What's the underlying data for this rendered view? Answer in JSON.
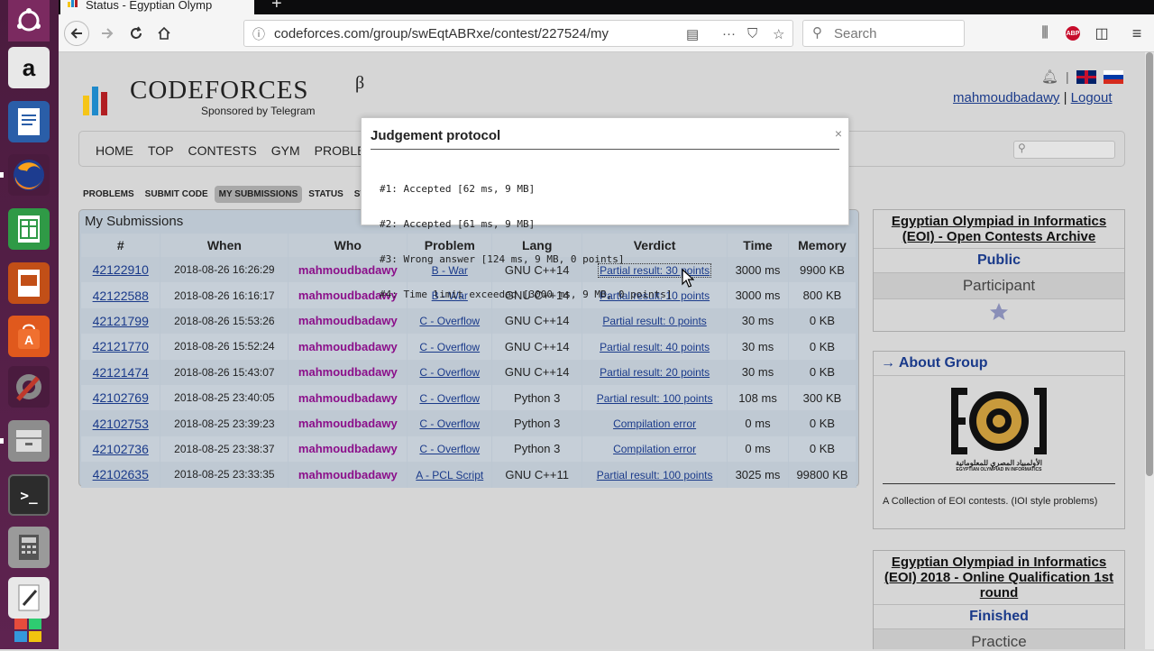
{
  "browser": {
    "tab_title": "Status - Egyptian Olymp",
    "url": "codeforces.com/group/swEqtABRxe/contest/227524/my",
    "search_placeholder": "Search"
  },
  "header": {
    "logo_text": "CODEFORCES",
    "logo_beta": "β",
    "sponsor": "Sponsored by Telegram",
    "username": "mahmoudbadawy",
    "separator": "|",
    "logout": "Logout"
  },
  "menu": [
    "HOME",
    "TOP",
    "CONTESTS",
    "GYM",
    "PROBLEMSET"
  ],
  "subnav": [
    "PROBLEMS",
    "SUBMIT CODE",
    "MY SUBMISSIONS",
    "STATUS",
    "STANDIN"
  ],
  "submissions": {
    "title": "My Submissions",
    "columns": [
      "#",
      "When",
      "Who",
      "Problem",
      "Lang",
      "Verdict",
      "Time",
      "Memory"
    ],
    "rows": [
      {
        "id": "42122910",
        "when": "2018-08-26 16:26:29",
        "who": "mahmoudbadawy",
        "problem": "B - War",
        "lang": "GNU C++14",
        "verdict": "Partial result: 30 points",
        "time": "3000 ms",
        "memory": "9900 KB"
      },
      {
        "id": "42122588",
        "when": "2018-08-26 16:16:17",
        "who": "mahmoudbadawy",
        "problem": "B - War",
        "lang": "GNU C++14",
        "verdict": "Partial result: 10 points",
        "time": "3000 ms",
        "memory": "800 KB"
      },
      {
        "id": "42121799",
        "when": "2018-08-26 15:53:26",
        "who": "mahmoudbadawy",
        "problem": "C - Overflow",
        "lang": "GNU C++14",
        "verdict": "Partial result: 0 points",
        "time": "30 ms",
        "memory": "0 KB"
      },
      {
        "id": "42121770",
        "when": "2018-08-26 15:52:24",
        "who": "mahmoudbadawy",
        "problem": "C - Overflow",
        "lang": "GNU C++14",
        "verdict": "Partial result: 40 points",
        "time": "30 ms",
        "memory": "0 KB"
      },
      {
        "id": "42121474",
        "when": "2018-08-26 15:43:07",
        "who": "mahmoudbadawy",
        "problem": "C - Overflow",
        "lang": "GNU C++14",
        "verdict": "Partial result: 20 points",
        "time": "30 ms",
        "memory": "0 KB"
      },
      {
        "id": "42102769",
        "when": "2018-08-25 23:40:05",
        "who": "mahmoudbadawy",
        "problem": "C - Overflow",
        "lang": "Python 3",
        "verdict": "Partial result: 100 points",
        "time": "108 ms",
        "memory": "300 KB"
      },
      {
        "id": "42102753",
        "when": "2018-08-25 23:39:23",
        "who": "mahmoudbadawy",
        "problem": "C - Overflow",
        "lang": "Python 3",
        "verdict": "Compilation error",
        "time": "0 ms",
        "memory": "0 KB"
      },
      {
        "id": "42102736",
        "when": "2018-08-25 23:38:37",
        "who": "mahmoudbadawy",
        "problem": "C - Overflow",
        "lang": "Python 3",
        "verdict": "Compilation error",
        "time": "0 ms",
        "memory": "0 KB"
      },
      {
        "id": "42102635",
        "when": "2018-08-25 23:33:35",
        "who": "mahmoudbadawy",
        "problem": "A - PCL Script",
        "lang": "GNU C++11",
        "verdict": "Partial result: 100 points",
        "time": "3025 ms",
        "memory": "99800 KB"
      }
    ]
  },
  "sidebar": {
    "archive_title": "Egyptian Olympiad in Informatics (EOI) - Open Contests Archive",
    "archive_visibility": "Public",
    "archive_role": "Participant",
    "about_title": "→ About Group",
    "about_desc": "A Collection of EOI contests. (IOI style problems)",
    "logo_caption_ar": "الأولمبياد المصري للمعلوماتية",
    "logo_caption_en": "EGYPTIAN OLYMPIAD IN INFORMATICS",
    "contest_title": "Egyptian Olympiad in Informatics (EOI) 2018 - Online Qualification 1st round",
    "contest_status": "Finished",
    "contest_mode": "Practice"
  },
  "modal": {
    "title": "Judgement protocol",
    "close": "×",
    "lines": [
      "#1: Accepted [62 ms, 9 MB]",
      "#2: Accepted [61 ms, 9 MB]",
      "#3: Wrong answer [124 ms, 9 MB, 0 points]",
      "#4: Time limit exceeded [3000 ms, 9 MB, 0 points]"
    ]
  },
  "colors": {
    "link": "#1a3a8a",
    "user": "#8b0f8a",
    "launcher": "#5a1f47"
  }
}
